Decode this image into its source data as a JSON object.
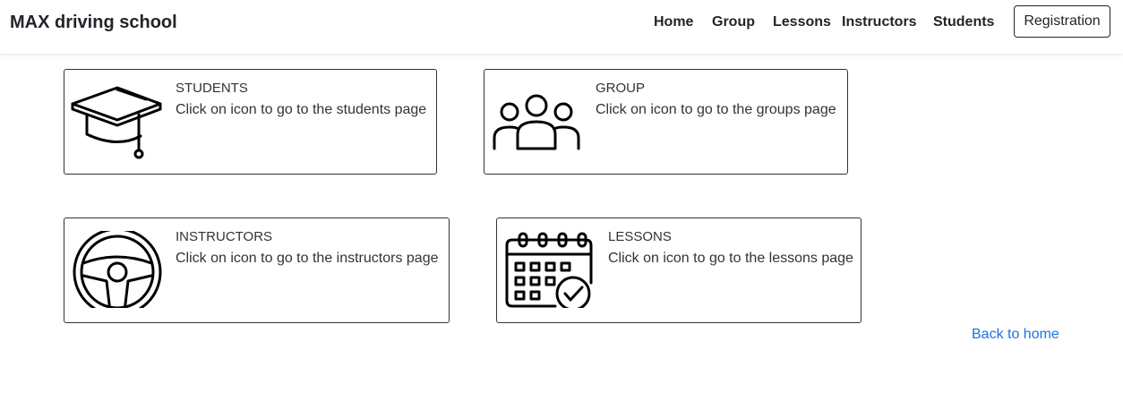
{
  "navbar": {
    "brand": "MAX driving school",
    "links": [
      "Home",
      "Group",
      "Lessons",
      "Instructors",
      "Students"
    ],
    "registration_label": "Registration"
  },
  "cards": [
    {
      "title": "STUDENTS",
      "description": "Click on icon to go to the students page",
      "icon": "graduation-cap-icon"
    },
    {
      "title": "GROUP",
      "description": "Click on icon to go to the groups page",
      "icon": "group-icon"
    },
    {
      "title": "INSTRUCTORS",
      "description": "Click on icon to go to the instructors page",
      "icon": "steering-wheel-icon"
    },
    {
      "title": "LESSONS",
      "description": "Click on icon to go to the lessons page",
      "icon": "calendar-check-icon"
    }
  ],
  "back_link": "Back to home",
  "colors": {
    "link": "#1a73e8",
    "text": "#212529",
    "border": "#333333"
  }
}
